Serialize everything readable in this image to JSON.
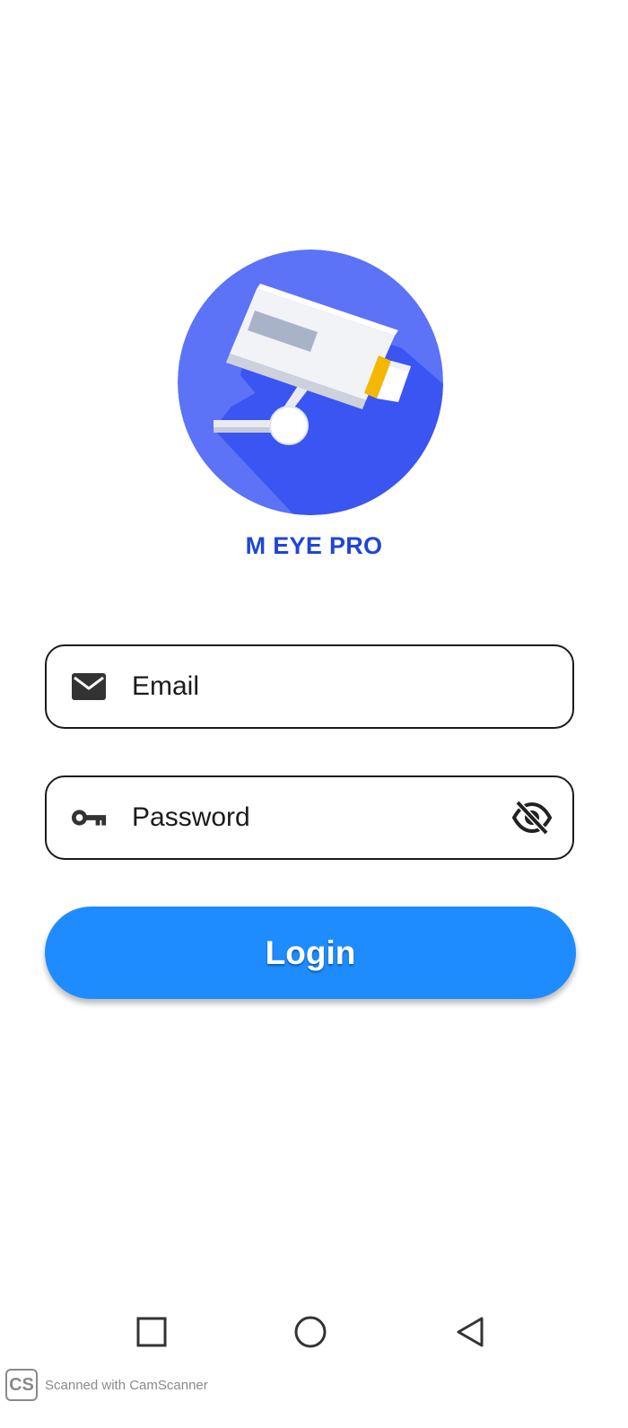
{
  "app": {
    "name": "M EYE PRO",
    "logo_icon": "security-camera-icon"
  },
  "form": {
    "email": {
      "placeholder": "Email",
      "icon": "mail-icon"
    },
    "password": {
      "placeholder": "Password",
      "icon": "key-icon",
      "toggle_icon": "eye-off-icon"
    },
    "login_label": "Login"
  },
  "colors": {
    "brand_text": "#1f45d8",
    "logo_circle": "#3a55f2",
    "login_button": "#1e8cff",
    "camera_lens": "#f5b800"
  },
  "nav_bar": {
    "recents_icon": "square-icon",
    "home_icon": "circle-icon",
    "back_icon": "triangle-back-icon"
  },
  "watermark": {
    "badge": "CS",
    "text": "Scanned with CamScanner"
  }
}
